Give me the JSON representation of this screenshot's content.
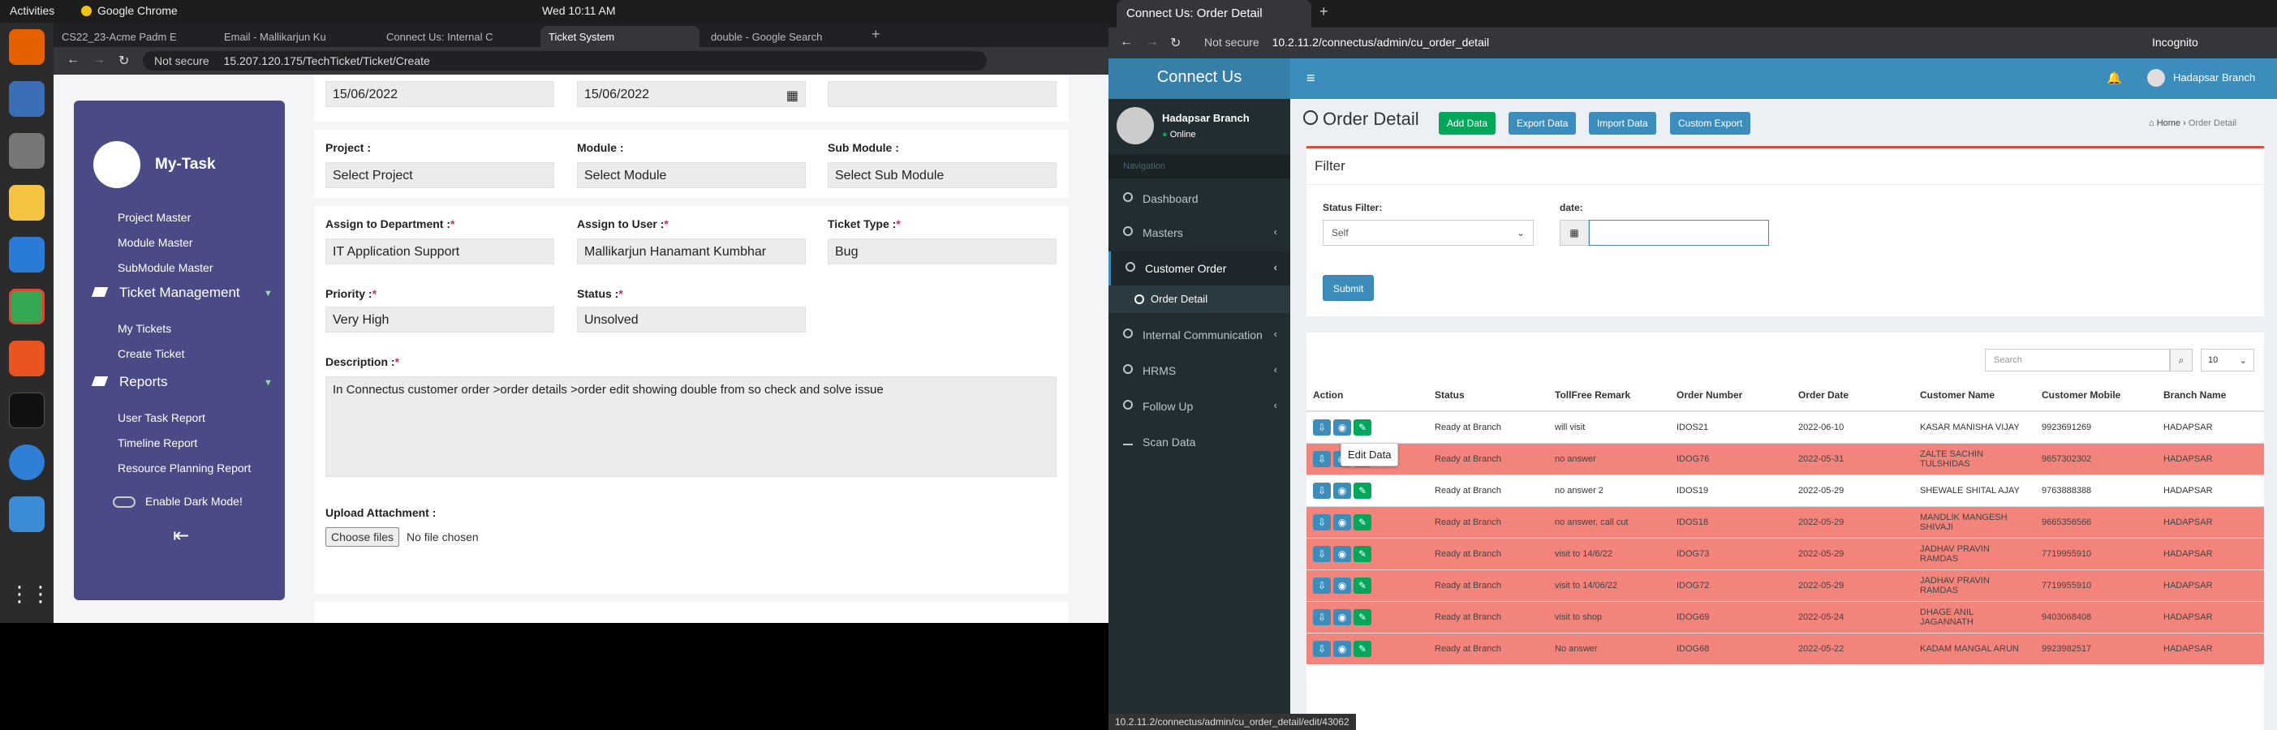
{
  "ubuntu": {
    "activities": "Activities",
    "app": "Google Chrome",
    "clock": "Wed 10:11 AM"
  },
  "left_browser": {
    "tabs": [
      {
        "label": "CS22_23-Acme Padm E"
      },
      {
        "label": "Email - Mallikarjun Ku"
      },
      {
        "label": "Connect Us: Internal C"
      },
      {
        "label": "Ticket System"
      },
      {
        "label": "double - Google Search"
      }
    ],
    "security": "Not secure",
    "url": "15.207.120.175/TechTicket/Ticket/Create"
  },
  "left_sidebar": {
    "brand": "My-Task",
    "links": [
      "Project Master",
      "Module Master",
      "SubModule Master"
    ],
    "ticket_head": "Ticket Management",
    "ticket_links": [
      "My Tickets",
      "Create Ticket"
    ],
    "reports_head": "Reports",
    "report_links": [
      "User Task Report",
      "Timeline Report",
      "Resource Planning Report"
    ],
    "dark_mode": "Enable Dark Mode!"
  },
  "form": {
    "date1": "15/06/2022",
    "date2": "15/06/2022",
    "project_label": "Project :",
    "project_value": "Select Project",
    "module_label": "Module :",
    "module_value": "Select Module",
    "submodule_label": "Sub Module :",
    "submodule_value": "Select Sub Module",
    "dept_label": "Assign to Department :",
    "dept_value": "IT Application Support",
    "user_label": "Assign to User :",
    "user_value": "Mallikarjun Hanamant Kumbhar",
    "type_label": "Ticket Type :",
    "type_value": "Bug",
    "priority_label": "Priority :",
    "priority_value": "Very High",
    "status_label": "Status :",
    "status_value": "Unsolved",
    "desc_label": "Description :",
    "desc_value": "In Connectus customer order >order details >order edit showing double from so check and solve issue",
    "upload_label": "Upload Attachment :",
    "choose": "Choose files",
    "nofile": "No file chosen",
    "req": "*"
  },
  "right_browser": {
    "tab": "Connect Us: Order Detail",
    "security": "Not secure",
    "url": "10.2.11.2/connectus/admin/cu_order_detail",
    "incognito": "Incognito",
    "status_url": "10.2.11.2/connectus/admin/cu_order_detail/edit/43062"
  },
  "connectus": {
    "brand": "Connect Us",
    "branch": "Hadapsar Branch",
    "online": "Online",
    "navigation": "Navigation",
    "nav": [
      "Dashboard",
      "Masters",
      "Customer Order",
      "Order Detail",
      "Internal Communication",
      "HRMS",
      "Follow Up",
      "Scan Data"
    ],
    "page_title": "Order Detail",
    "buttons": [
      "Add Data",
      "Export Data",
      "Import Data",
      "Custom Export"
    ],
    "breadcrumb_home": "Home",
    "breadcrumb_current": "Order Detail",
    "filter": "Filter",
    "status_filter_label": "Status Filter:",
    "status_filter_value": "Self",
    "date_label": "date:",
    "submit": "Submit",
    "search_placeholder": "Search",
    "page_size": "10",
    "tooltip": "Edit Data",
    "columns": [
      "Action",
      "Status",
      "TollFree Remark",
      "Order Number",
      "Order Date",
      "Customer Name",
      "Customer Mobile",
      "Branch Name"
    ],
    "rows": [
      {
        "status": "Ready at Branch",
        "remark": "will visit",
        "order": "IDOS21",
        "date": "2022-06-10",
        "name": "KASAR MANISHA VIJAY",
        "mobile": "9923691269",
        "branch": "HADAPSAR",
        "red": false
      },
      {
        "status": "Ready at Branch",
        "remark": "no answer",
        "order": "IDOG76",
        "date": "2022-05-31",
        "name": "ZALTE SACHIN TULSHIDAS",
        "mobile": "9657302302",
        "branch": "HADAPSAR",
        "red": true
      },
      {
        "status": "Ready at Branch",
        "remark": "no answer 2",
        "order": "IDOS19",
        "date": "2022-05-29",
        "name": "SHEWALE SHITAL AJAY",
        "mobile": "9763888388",
        "branch": "HADAPSAR",
        "red": false
      },
      {
        "status": "Ready at Branch",
        "remark": "no answer, call cut",
        "order": "IDOS18",
        "date": "2022-05-29",
        "name": "MANDLIK MANGESH SHIVAJI",
        "mobile": "9665356566",
        "branch": "HADAPSAR",
        "red": true
      },
      {
        "status": "Ready at Branch",
        "remark": "visit to 14/6/22",
        "order": "IDOG73",
        "date": "2022-05-29",
        "name": "JADHAV PRAVIN RAMDAS",
        "mobile": "7719955910",
        "branch": "HADAPSAR",
        "red": true
      },
      {
        "status": "Ready at Branch",
        "remark": "visit to 14/06/22",
        "order": "IDOG72",
        "date": "2022-05-29",
        "name": "JADHAV PRAVIN RAMDAS",
        "mobile": "7719955910",
        "branch": "HADAPSAR",
        "red": true
      },
      {
        "status": "Ready at Branch",
        "remark": "visit to shop",
        "order": "IDOG69",
        "date": "2022-05-24",
        "name": "DHAGE ANIL JAGANNATH",
        "mobile": "9403068408",
        "branch": "HADAPSAR",
        "red": true
      },
      {
        "status": "Ready at Branch",
        "remark": "No answer",
        "order": "IDOG68",
        "date": "2022-05-22",
        "name": "KADAM MANGAL ARUN",
        "mobile": "9923982517",
        "branch": "HADAPSAR",
        "red": true
      }
    ]
  },
  "colors": {
    "sidebar": "#4a4b86",
    "cu_header": "#3c8dbc",
    "cu_sidebar": "#222d32",
    "row_red": "#f2847b",
    "green": "#00a65a"
  }
}
